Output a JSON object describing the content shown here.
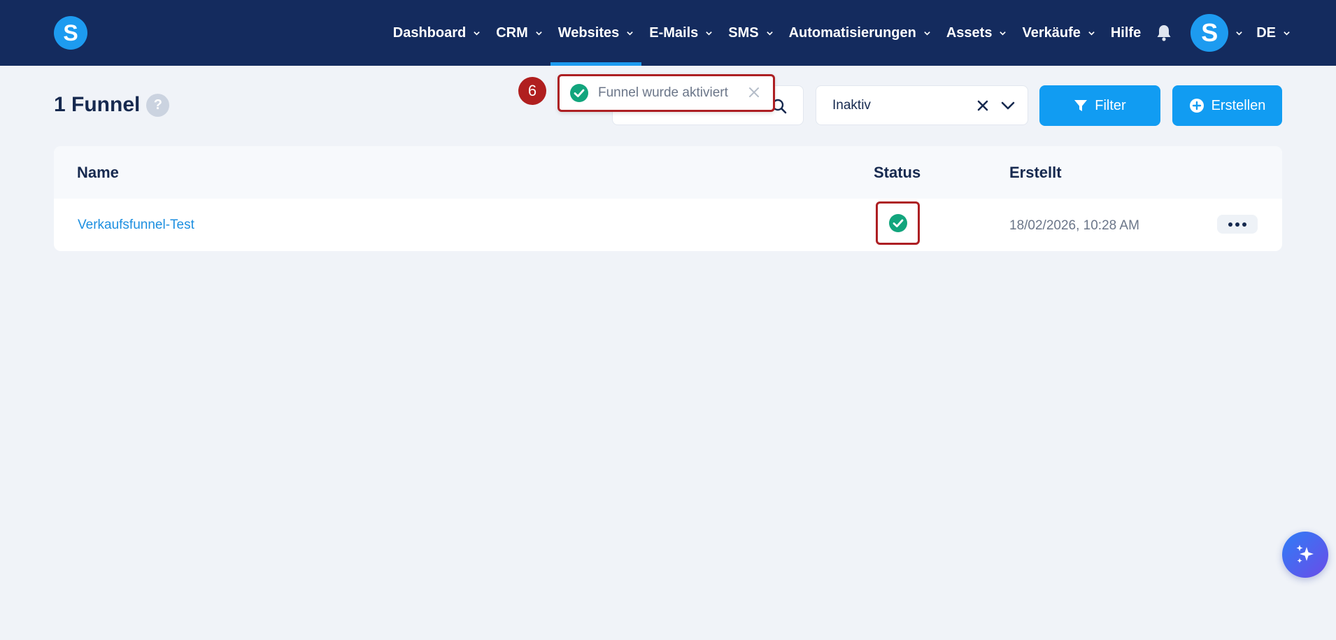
{
  "nav": {
    "logo_letter": "S",
    "items": [
      {
        "label": "Dashboard",
        "active": false
      },
      {
        "label": "CRM",
        "active": false
      },
      {
        "label": "Websites",
        "active": true
      },
      {
        "label": "E-Mails",
        "active": false
      },
      {
        "label": "SMS",
        "active": false
      },
      {
        "label": "Automatisierungen",
        "active": false
      },
      {
        "label": "Assets",
        "active": false
      },
      {
        "label": "Verkäufe",
        "active": false
      }
    ],
    "help_label": "Hilfe",
    "bell_icon": "bell-icon",
    "avatar_letter": "S",
    "language": "DE"
  },
  "page": {
    "title": "1 Funnel",
    "help_icon_text": "?"
  },
  "search": {
    "value": "",
    "placeholder": ""
  },
  "status_filter": {
    "selected": "Inaktiv"
  },
  "buttons": {
    "filter_label": "Filter",
    "create_label": "Erstellen"
  },
  "toast": {
    "step_number": "6",
    "message": "Funnel wurde aktiviert",
    "close_glyph": "×"
  },
  "table": {
    "columns": [
      "Name",
      "Status",
      "Erstellt"
    ],
    "rows": [
      {
        "name": "Verkaufsfunnel-Test",
        "status": "active",
        "created": "18/02/2026, 10:28 AM"
      }
    ]
  },
  "colors": {
    "nav_bg": "#142b5e",
    "accent": "#119cf2",
    "success": "#12a57d",
    "highlight": "#ad1f23"
  }
}
